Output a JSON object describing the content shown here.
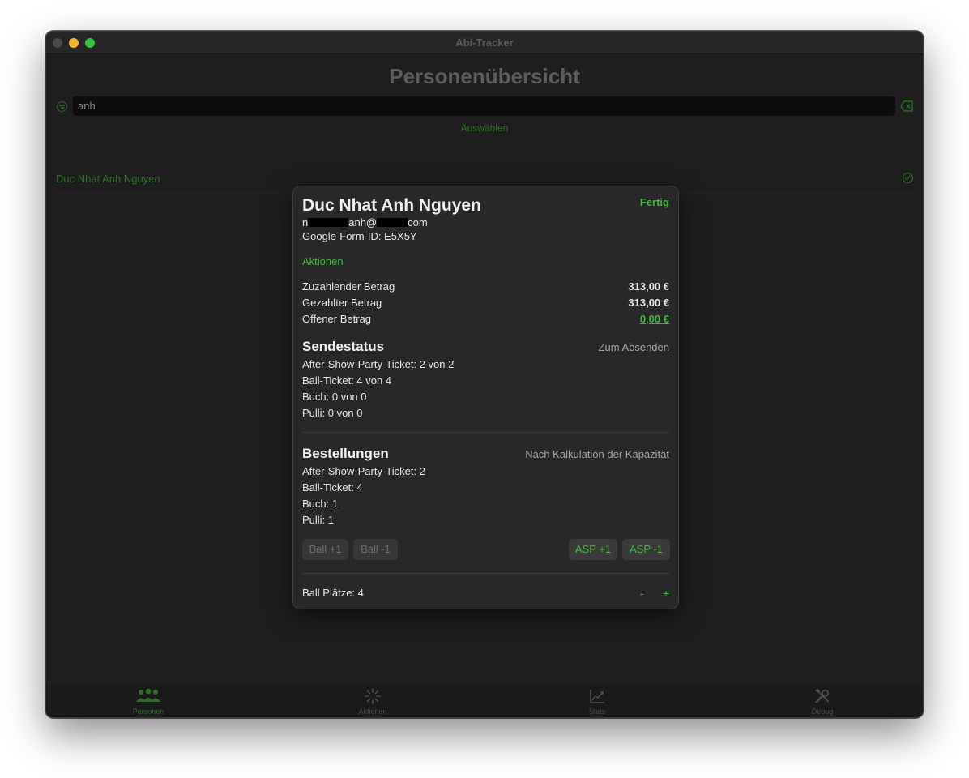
{
  "window": {
    "title": "Abi-Tracker"
  },
  "header": {
    "page_title": "Personenübersicht"
  },
  "search": {
    "value": "anh",
    "select_label": "Auswählen"
  },
  "list": {
    "rows": [
      {
        "name": "Duc Nhat Anh Nguyen"
      }
    ]
  },
  "detail": {
    "name": "Duc Nhat Anh Nguyen",
    "email_parts": [
      "n",
      "anh@",
      "com"
    ],
    "form_id": "Google-Form-ID: E5X5Y",
    "done_label": "Fertig",
    "actions_label": "Aktionen",
    "amounts": [
      {
        "label": "Zuzahlender Betrag",
        "value": "313,00 €"
      },
      {
        "label": "Gezahlter Betrag",
        "value": "313,00 €"
      },
      {
        "label": "Offener Betrag",
        "value": "0,00 €"
      }
    ],
    "send_status": {
      "title": "Sendestatus",
      "note": "Zum Absenden",
      "lines": [
        "After-Show-Party-Ticket: 2 von 2",
        "Ball-Ticket: 4 von 4",
        "Buch: 0 von 0",
        "Pulli: 0 von 0"
      ]
    },
    "orders": {
      "title": "Bestellungen",
      "note": "Nach Kalkulation der Kapazität",
      "lines": [
        "After-Show-Party-Ticket: 2",
        "Ball-Ticket: 4",
        "Buch: 1",
        "Pulli: 1"
      ]
    },
    "buttons": {
      "ball_plus": "Ball +1",
      "ball_minus": "Ball -1",
      "asp_plus": "ASP +1",
      "asp_minus": "ASP -1"
    },
    "ball_seats": {
      "label": "Ball Plätze: 4",
      "minus": "-",
      "plus": "+"
    }
  },
  "tabs": [
    {
      "label": "Personen",
      "icon": "people-icon",
      "active": true
    },
    {
      "label": "Aktionen",
      "icon": "sparkle-icon",
      "active": false
    },
    {
      "label": "Stats",
      "icon": "chart-icon",
      "active": false
    },
    {
      "label": "Debug",
      "icon": "tools-icon",
      "active": false
    }
  ],
  "colors": {
    "accent": "#3dbb3d",
    "accent_dim": "#2f6e27",
    "background": "#1e1e1e",
    "sheet": "#282828"
  }
}
